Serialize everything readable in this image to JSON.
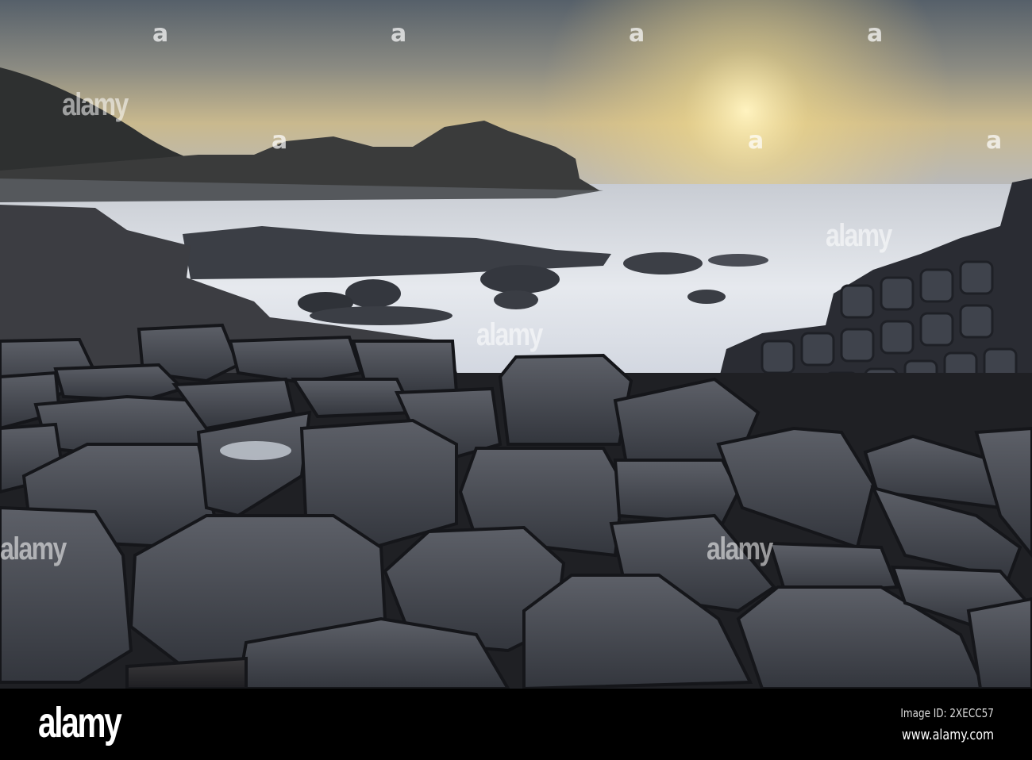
{
  "photo": {
    "subject": "Basalt columns on coast at sunset"
  },
  "watermark": {
    "text": "alamy"
  },
  "footer": {
    "logo": "alamy",
    "image_id": "Image ID: 2XECC57",
    "website": "www.alamy.com"
  }
}
